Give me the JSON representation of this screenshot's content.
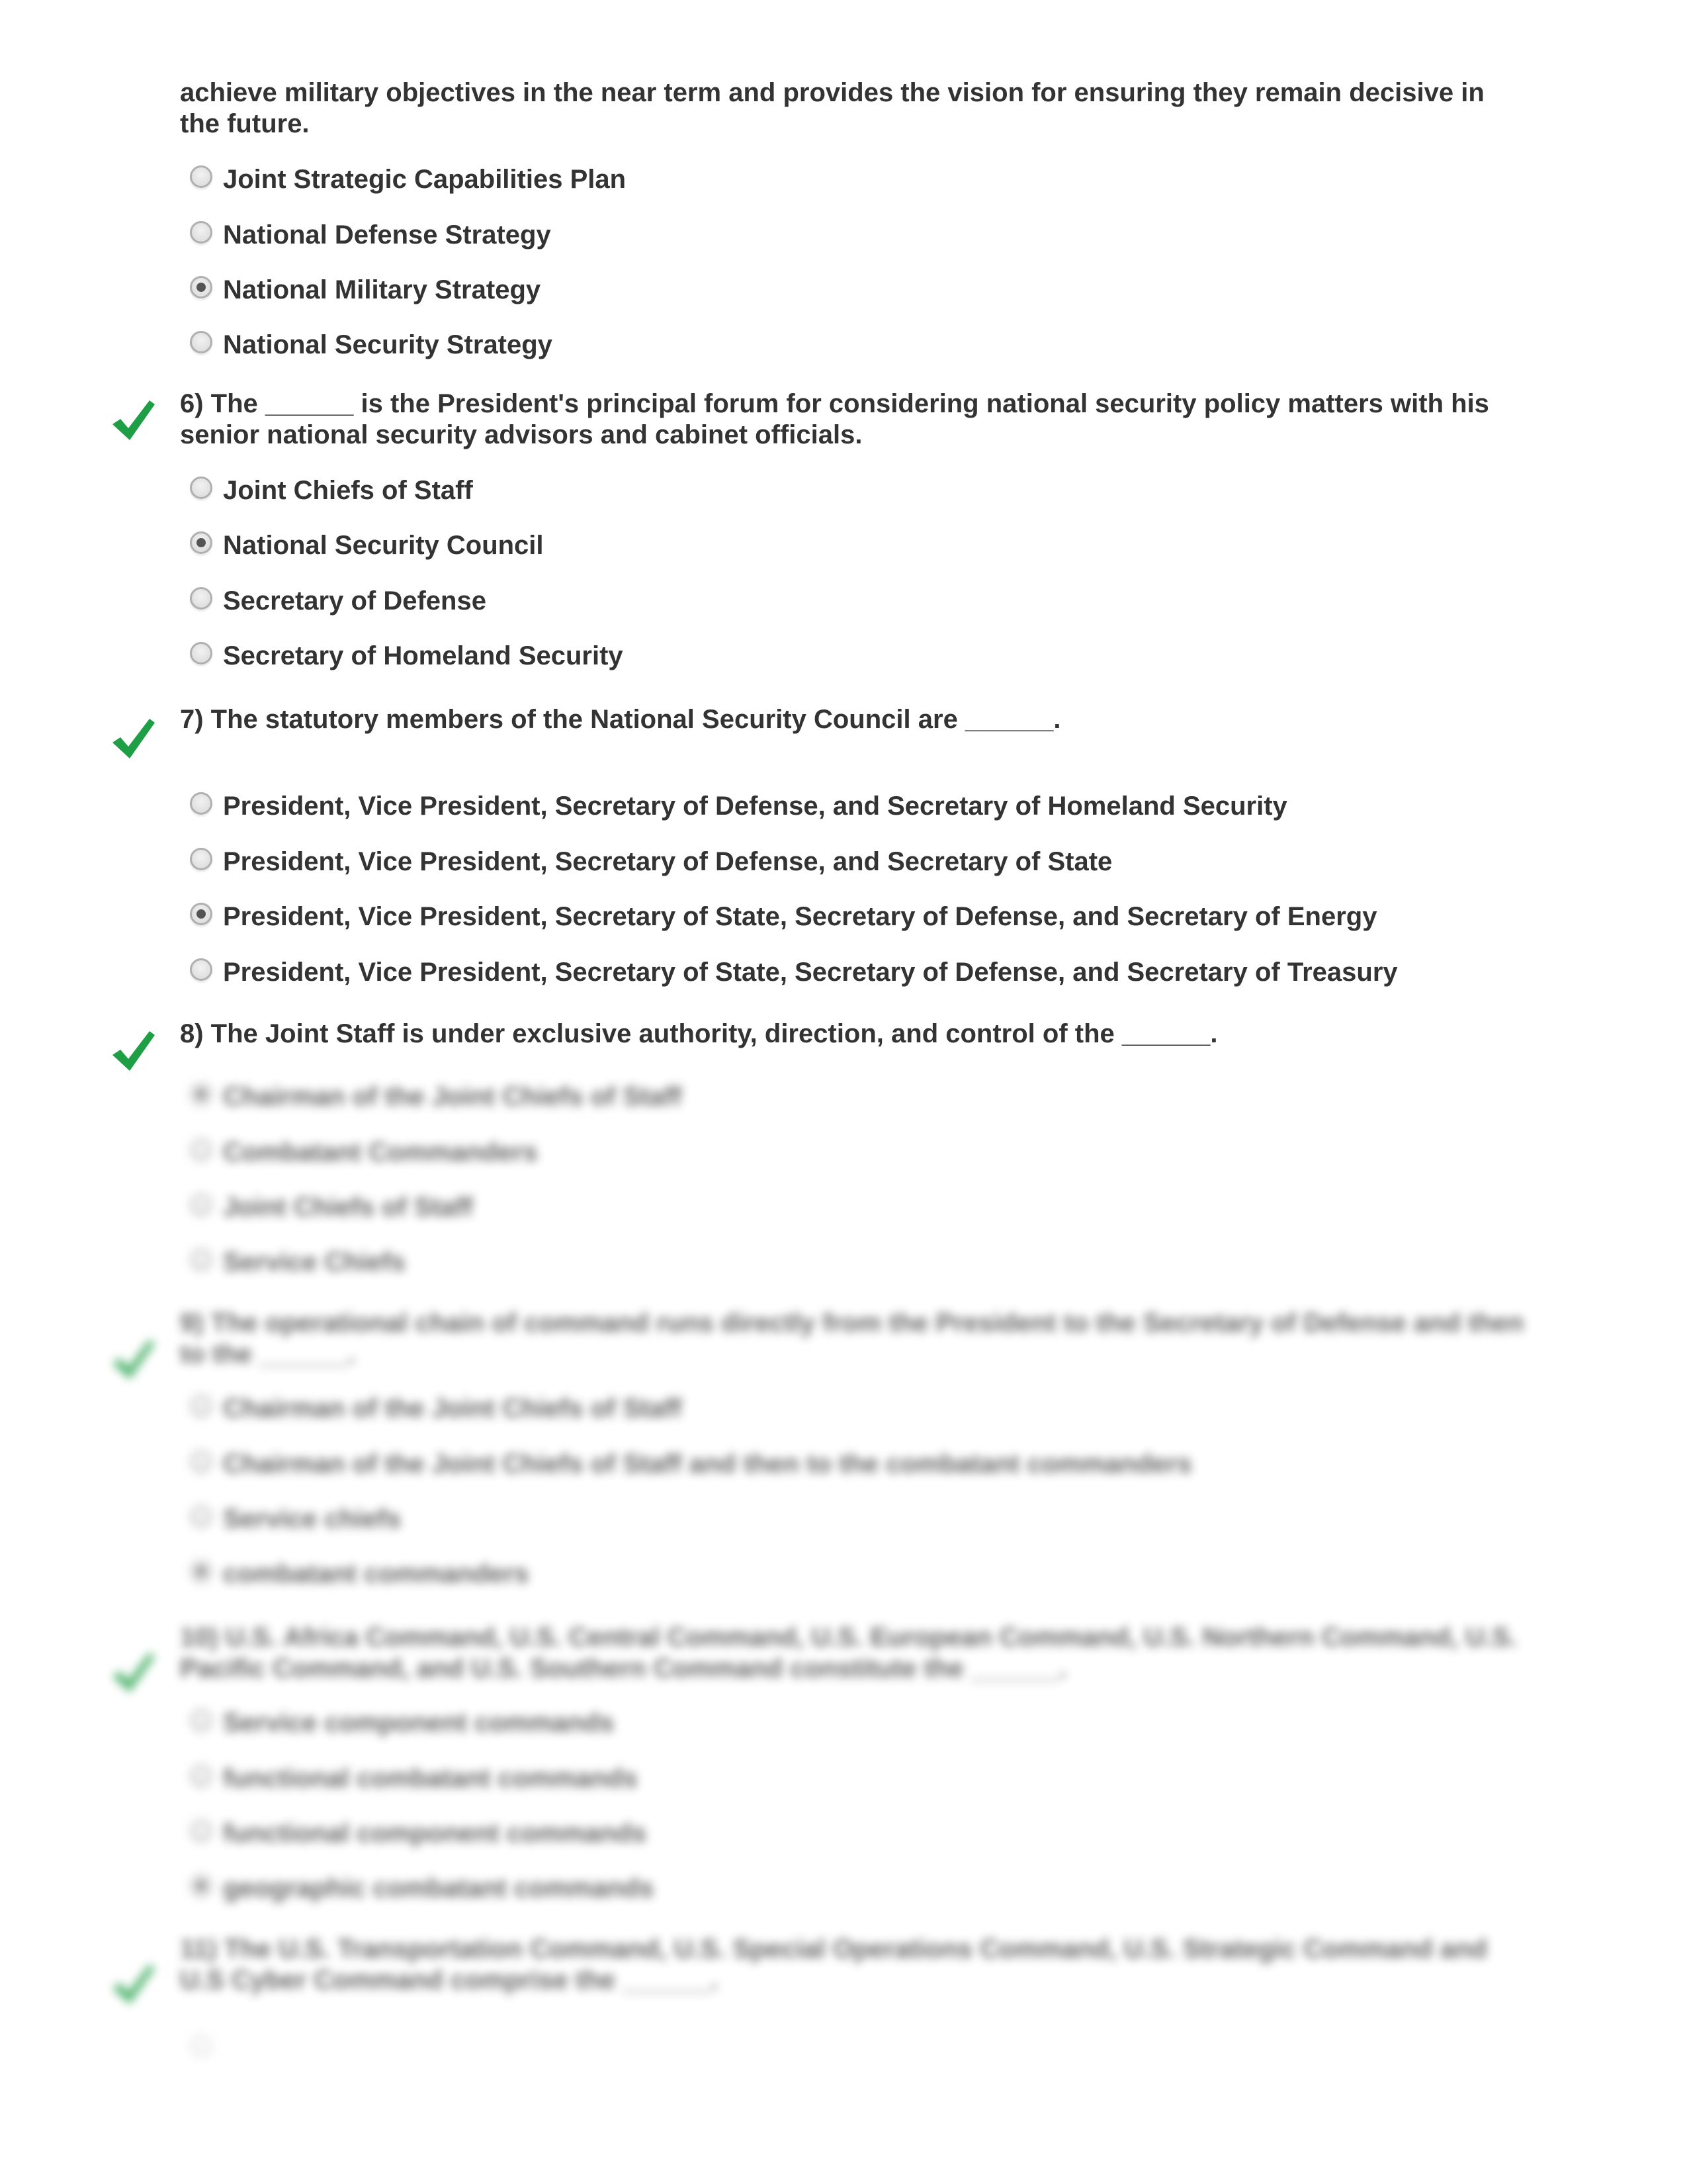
{
  "colors": {
    "text": "#333333",
    "check": "#1e9e45",
    "radio_border": "#b0b0b0",
    "radio_dot": "#555555"
  },
  "intro": {
    "line1": "achieve military objectives in the near term and provides the vision for ensuring they remain decisive in",
    "line2": "the future."
  },
  "q5_options": [
    {
      "label": "Joint Strategic Capabilities Plan",
      "selected": false
    },
    {
      "label": "National Defense Strategy",
      "selected": false
    },
    {
      "label": "National Military Strategy",
      "selected": true
    },
    {
      "label": "National Security Strategy",
      "selected": false
    }
  ],
  "questions": [
    {
      "number": "6)",
      "line1": "6) The ______ is the President's principal forum for considering national security policy matters with his",
      "line2": "senior national security advisors and cabinet officials.",
      "status_icon": "check-icon",
      "options": [
        {
          "label": "Joint Chiefs of Staff",
          "selected": false
        },
        {
          "label": "National Security Council",
          "selected": true
        },
        {
          "label": "Secretary of Defense",
          "selected": false
        },
        {
          "label": "Secretary of Homeland Security",
          "selected": false
        }
      ]
    },
    {
      "number": "7)",
      "line1": "7) The statutory members of the National Security Council are ______.",
      "status_icon": "check-icon",
      "options": [
        {
          "label": "President, Vice President, Secretary of Defense, and Secretary of Homeland Security",
          "selected": false
        },
        {
          "label": "President, Vice President, Secretary of Defense, and Secretary of State",
          "selected": false
        },
        {
          "label": "President, Vice President, Secretary of State, Secretary of Defense, and Secretary of Energy",
          "selected": true
        },
        {
          "label": "President, Vice President, Secretary of State, Secretary of Defense, and Secretary of Treasury",
          "selected": false
        }
      ]
    },
    {
      "number": "8)",
      "line1": "8) The Joint Staff is under exclusive authority, direction, and control of the ______.",
      "status_icon": "check-icon",
      "options": [
        {
          "label": "Chairman of the Joint Chiefs of Staff",
          "selected": true
        },
        {
          "label": "Combatant Commanders",
          "selected": false
        },
        {
          "label": "Joint Chiefs of Staff",
          "selected": false
        },
        {
          "label": "Service Chiefs",
          "selected": false
        }
      ]
    },
    {
      "number": "9)",
      "line1": "9) The operational chain of command runs directly from the President to the Secretary of Defense and then",
      "line2": "to the ______.",
      "status_icon": "check-icon",
      "options": [
        {
          "label": "Chairman of the Joint Chiefs of Staff",
          "selected": false
        },
        {
          "label": "Chairman of the Joint Chiefs of Staff and then to the combatant commanders",
          "selected": false
        },
        {
          "label": "Service chiefs",
          "selected": false
        },
        {
          "label": "combatant commanders",
          "selected": true
        }
      ]
    },
    {
      "number": "10)",
      "line1": "10) U.S. Africa Command, U.S. Central Command, U.S. European Command, U.S. Northern Command, U.S.",
      "line2": "Pacific Command, and U.S. Southern Command constitute the ______.",
      "status_icon": "check-icon",
      "options": [
        {
          "label": "Service component commands",
          "selected": false
        },
        {
          "label": "functional combatant commands",
          "selected": false
        },
        {
          "label": "functional component commands",
          "selected": false
        },
        {
          "label": "geographic combatant commands",
          "selected": true
        }
      ]
    },
    {
      "number": "11)",
      "line1": "11) The U.S. Transportation Command, U.S. Special Operations Command, U.S. Strategic Command and",
      "line2": "U.S Cyber Command comprise the ______.",
      "status_icon": "check-icon",
      "options": [
        {
          "label": "",
          "selected": false
        }
      ]
    }
  ]
}
